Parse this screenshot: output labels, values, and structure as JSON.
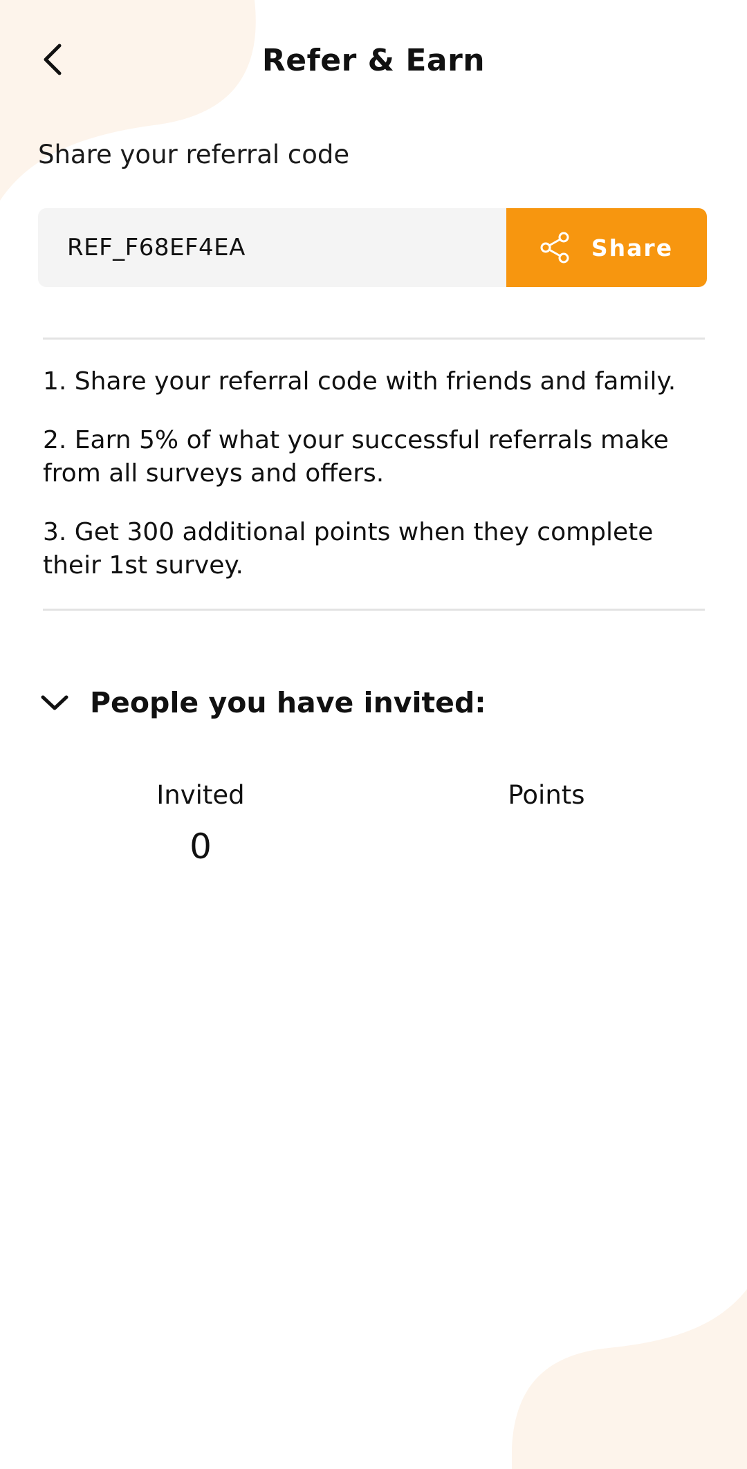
{
  "colors": {
    "accent": "#f7960f",
    "blob": "#fdf4eb",
    "code_bg": "#f4f4f4",
    "divider": "#e3e3e3"
  },
  "header": {
    "back_icon": "chevron-left-icon",
    "title": "Refer & Earn"
  },
  "referral": {
    "label": "Share your referral code",
    "code": "REF_F68EF4EA",
    "share_icon": "share-icon",
    "share_label": "Share"
  },
  "steps": [
    "1. Share your referral code with friends and family.",
    "2. Earn 5% of what your successful referrals make from all surveys and offers.",
    "3. Get 300 additional points when they complete their 1st survey."
  ],
  "invited": {
    "toggle_icon": "chevron-down-icon",
    "title": "People you have invited:",
    "columns": {
      "invited_label": "Invited",
      "invited_value": "0",
      "points_label": "Points",
      "points_value": ""
    }
  }
}
